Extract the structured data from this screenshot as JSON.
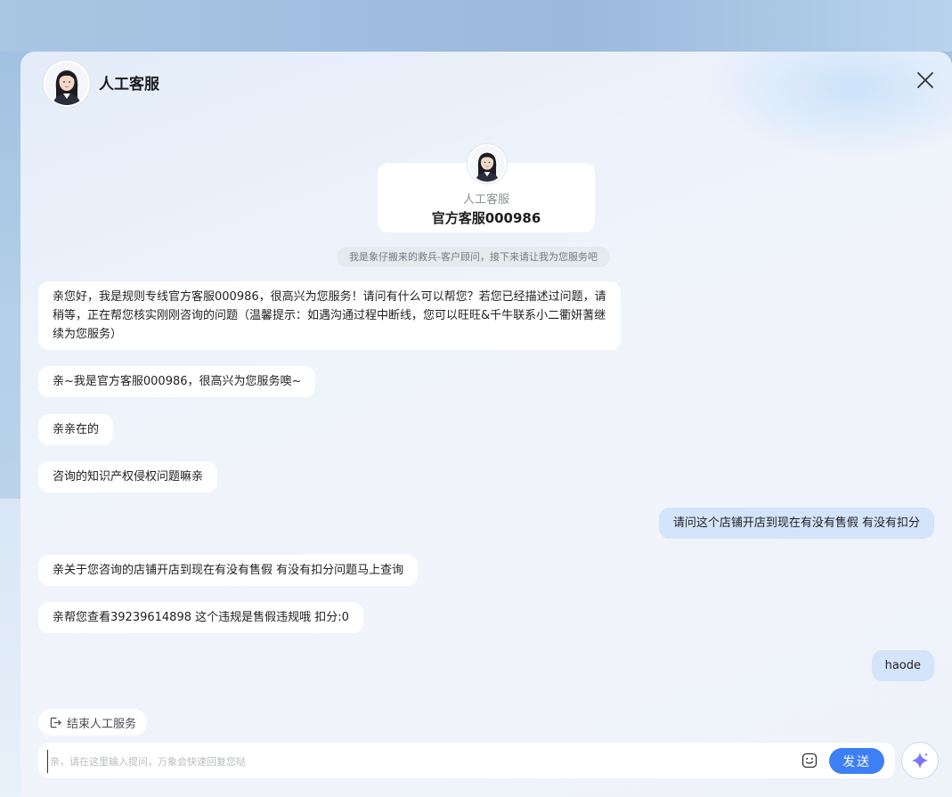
{
  "header": {
    "title": "人工客服"
  },
  "agent_card": {
    "role": "人工客服",
    "name": "官方客服000986"
  },
  "system_note": "我是象仔搬来的救兵-客户顾问，接下来请让我为您服务吧",
  "messages": [
    {
      "from": "agent",
      "text": "亲您好，我是规则专线官方客服000986，很高兴为您服务！请问有什么可以帮您？若您已经描述过问题，请稍等，正在帮您核实刚刚咨询的问题（温馨提示：如遇沟通过程中断线，您可以旺旺&千牛联系小二衢妍蓍继续为您服务）"
    },
    {
      "from": "agent",
      "text": "亲~我是官方客服000986，很高兴为您服务噢~"
    },
    {
      "from": "agent",
      "text": "亲亲在的"
    },
    {
      "from": "agent",
      "text": "咨询的知识产权侵权问题嘛亲"
    },
    {
      "from": "user",
      "text": "请问这个店铺开店到现在有没有售假 有没有扣分"
    },
    {
      "from": "agent",
      "text": "亲关于您咨询的店铺开店到现在有没有售假 有没有扣分问题马上查询"
    },
    {
      "from": "agent",
      "text": "亲帮您查看39239614898 这个违规是售假违规哦 扣分:0"
    },
    {
      "from": "user",
      "text": "haode"
    }
  ],
  "footer": {
    "end_service_label": "结束人工服务",
    "input_placeholder": "亲，请在这里输入提问，万象会快速回复您哒",
    "input_value": "",
    "send_label": "发送"
  },
  "colors": {
    "accent": "#3d7ff5",
    "user_bubble": "#d3e4fb"
  },
  "icons": [
    "close-icon",
    "emoji-icon",
    "logout-icon",
    "sparkle-icon",
    "avatar"
  ]
}
